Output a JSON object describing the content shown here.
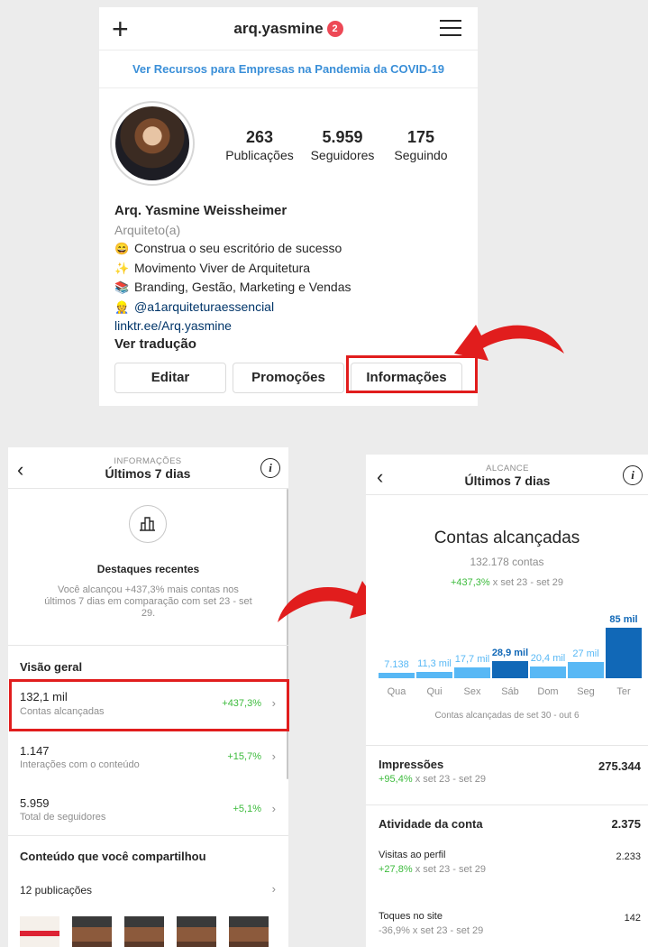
{
  "profile": {
    "username": "arq.yasmine",
    "badge": "2",
    "covid_link": "Ver Recursos para Empresas na Pandemia da COVID-19",
    "stats": [
      {
        "value": "263",
        "label": "Publicações"
      },
      {
        "value": "5.959",
        "label": "Seguidores"
      },
      {
        "value": "175",
        "label": "Seguindo"
      }
    ],
    "name": "Arq. Yasmine Weissheimer",
    "category": "Arquiteto(a)",
    "bio": [
      {
        "emoji": "😄",
        "text": "Construa o seu escritório de sucesso"
      },
      {
        "emoji": "✨",
        "text": "Movimento Viver de Arquitetura"
      },
      {
        "emoji": "📚",
        "text": "Branding, Gestão, Marketing e Vendas"
      },
      {
        "emoji": "👷",
        "text": "@a1arquiteturaessencial"
      }
    ],
    "link": "linktr.ee/Arq.yasmine",
    "translate": "Ver tradução",
    "buttons": [
      "Editar",
      "Promoções",
      "Informações"
    ]
  },
  "insights": {
    "overline": "INFORMAÇÕES",
    "period": "Últimos 7 dias",
    "highlights_title": "Destaques recentes",
    "highlights_text": "Você alcançou +437,3% mais contas nos últimos 7 dias em comparação com set 23 - set 29.",
    "overview_title": "Visão geral",
    "rows": [
      {
        "value": "132,1 mil",
        "label": "Contas alcançadas",
        "delta": "+437,3%"
      },
      {
        "value": "1.147",
        "label": "Interações com o conteúdo",
        "delta": "+15,7%"
      },
      {
        "value": "5.959",
        "label": "Total de seguidores",
        "delta": "+5,1%"
      }
    ],
    "shared_title": "Conteúdo que você compartilhou",
    "posts": "12 publicações"
  },
  "reach": {
    "overline": "ALCANCE",
    "period": "Últimos 7 dias",
    "title": "Contas alcançadas",
    "count": "132.178 contas",
    "delta": "+437,3%",
    "compare": "x set 23 - set 29",
    "chart_data": {
      "type": "bar",
      "categories": [
        "Qua",
        "Qui",
        "Sex",
        "Sáb",
        "Dom",
        "Seg",
        "Ter"
      ],
      "values": [
        7138,
        11300,
        17700,
        28900,
        20400,
        27000,
        85000
      ],
      "labels": [
        "7.138",
        "11,3 mil",
        "17,7 mil",
        "28,9 mil",
        "20,4 mil",
        "27 mil",
        "85 mil"
      ],
      "highlight": [
        false,
        false,
        false,
        true,
        false,
        false,
        true
      ],
      "colors": {
        "normal": "#58b8f5",
        "highlight": "#1168b7"
      },
      "caption": "Contas alcançadas de set 30 - out 6"
    },
    "impressions": {
      "label": "Impressões",
      "value": "275.344",
      "delta": "+95,4%",
      "compare": "x set 23 - set 29"
    },
    "activity": {
      "label": "Atividade da conta",
      "value": "2.375"
    },
    "visits": {
      "label": "Visitas ao perfil",
      "value": "2.233",
      "delta": "+27,8%",
      "compare": "x set 23 - set 29"
    },
    "taps": {
      "label": "Toques no site",
      "value": "142",
      "delta": "-36,9%",
      "compare": "x set 23 - set 29"
    }
  }
}
